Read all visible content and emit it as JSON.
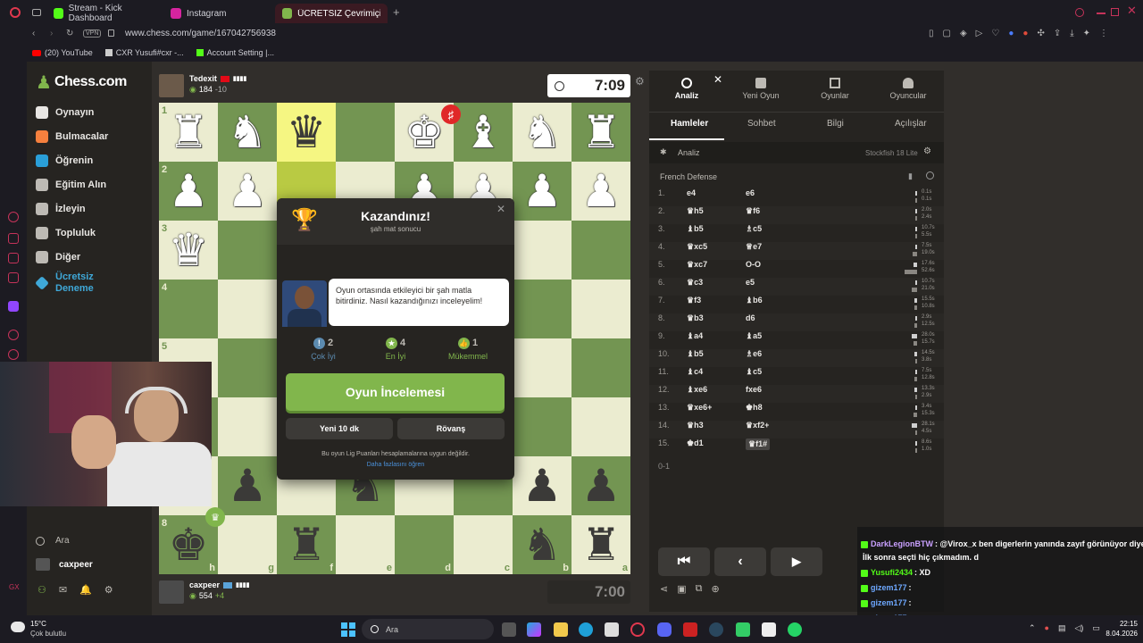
{
  "browser": {
    "tabs": [
      {
        "label": "Stream - Kick Dashboard"
      },
      {
        "label": "Instagram"
      },
      {
        "label": "ÜCRETSİZ Çevrimiçi Satra"
      }
    ],
    "vpn": "VPN",
    "url": "www.chess.com/game/167042756938",
    "bookmarks": [
      "(20) YouTube",
      "CXR Yusufi#cxr -...",
      "Account Setting |..."
    ]
  },
  "sidebar": {
    "logo": "Chess.com",
    "items": [
      {
        "label": "Oynayın",
        "icon": "pawn-icon",
        "color": "#e8e6e3"
      },
      {
        "label": "Bulmacalar",
        "icon": "puzzle-icon",
        "color": "#f5803e"
      },
      {
        "label": "Öğrenin",
        "icon": "learn-icon",
        "color": "#2a9fd8"
      },
      {
        "label": "Eğitim Alın",
        "icon": "coach-icon",
        "color": "#bdbab4"
      },
      {
        "label": "İzleyin",
        "icon": "binoculars-icon",
        "color": "#bdbab4"
      },
      {
        "label": "Topluluk",
        "icon": "community-icon",
        "color": "#bdbab4"
      },
      {
        "label": "Diğer",
        "icon": "more-icon",
        "color": "#bdbab4"
      },
      {
        "label": "Ücretsiz\nDeneme",
        "icon": "diamond-icon",
        "color": "#3fa8d8"
      }
    ],
    "search_label": "Ara",
    "user": "caxpeer"
  },
  "top_player": {
    "name": "Tedexit",
    "rating": "184",
    "delta": "-10",
    "clock": "7:09"
  },
  "bottom_player": {
    "name": "caxpeer",
    "rating": "554",
    "delta": "+4",
    "clock": "7:00"
  },
  "board": {
    "ranks": [
      "1",
      "2",
      "3",
      "4",
      "5",
      "6",
      "7",
      "8"
    ],
    "files": [
      "h",
      "g",
      "f",
      "e",
      "d",
      "c",
      "b",
      "a"
    ],
    "rows": [
      [
        "wR",
        "wN",
        "bQ",
        "",
        "wK",
        "wB",
        "wN",
        "wR"
      ],
      [
        "wP",
        "wP",
        "",
        "",
        "wP",
        "wP",
        "wP",
        "wP"
      ],
      [
        "wQ",
        "",
        "",
        "",
        "",
        "",
        "",
        ""
      ],
      [
        "",
        "",
        "",
        "",
        "",
        "",
        "",
        ""
      ],
      [
        "",
        "",
        "",
        "",
        "",
        "",
        "",
        ""
      ],
      [
        "",
        "",
        "",
        "",
        "",
        "",
        "",
        ""
      ],
      [
        "",
        "bP",
        "",
        "bN",
        "",
        "",
        "bP",
        "bP"
      ],
      [
        "bK",
        "",
        "bR",
        "",
        "",
        "",
        "bN",
        "bR"
      ]
    ]
  },
  "modal": {
    "title": "Kazandınız!",
    "subtitle": "şah mat sonucu",
    "coach_text": "Oyun ortasında etkileyici bir şah matla bitirdiniz. Nasıl kazandığınızı inceleyelim!",
    "stats": [
      {
        "value": "2",
        "label": "Çok İyi",
        "color": "#5c8bb0"
      },
      {
        "value": "4",
        "label": "En İyi",
        "color": "#81b64c"
      },
      {
        "value": "1",
        "label": "Mükemmel",
        "color": "#81b64c"
      }
    ],
    "review_button": "Oyun İncelemesi",
    "new_game_button": "Yeni 10 dk",
    "rematch_button": "Rövanş",
    "note": "Bu oyun Lig Puanları hesaplamalarına uygun değildir.",
    "learn_more": "Daha fazlasını öğren"
  },
  "panel": {
    "tabs": [
      "Analiz",
      "Yeni Oyun",
      "Oyunlar",
      "Oyuncular"
    ],
    "subtabs": [
      "Hamleler",
      "Sohbet",
      "Bilgi",
      "Açılışlar"
    ],
    "analysis_label": "Analiz",
    "engine": "Stockfish 18 Lite",
    "opening": "French Defense",
    "moves": [
      {
        "n": "1.",
        "w": "e4",
        "b": "e6",
        "tw": "0.1s",
        "tb": "0.1s",
        "fw": 0.01,
        "fb": 0.01
      },
      {
        "n": "2.",
        "w": "♛h5",
        "b": "♛f6",
        "tw": "2.0s",
        "tb": "2.4s",
        "fw": 0.04,
        "fb": 0.05
      },
      {
        "n": "3.",
        "w": "♝b5",
        "b": "♗c5",
        "tw": "10.7s",
        "tb": "5.5s",
        "fw": 0.2,
        "fb": 0.1
      },
      {
        "n": "4.",
        "w": "♛xc5",
        "b": "♕e7",
        "tw": "7.5s",
        "tb": "19.0s",
        "fw": 0.14,
        "fb": 0.36
      },
      {
        "n": "5.",
        "w": "♛xc7",
        "b": "O-O",
        "tw": "17.6s",
        "tb": "52.6s",
        "fw": 0.33,
        "fb": 1.0
      },
      {
        "n": "6.",
        "w": "♛c3",
        "b": "e5",
        "tw": "10.7s",
        "tb": "21.0s",
        "fw": 0.2,
        "fb": 0.4
      },
      {
        "n": "7.",
        "w": "♛f3",
        "b": "♝b6",
        "tw": "15.5s",
        "tb": "10.8s",
        "fw": 0.29,
        "fb": 0.2
      },
      {
        "n": "8.",
        "w": "♛b3",
        "b": "d6",
        "tw": "2.9s",
        "tb": "12.5s",
        "fw": 0.05,
        "fb": 0.24
      },
      {
        "n": "9.",
        "w": "♝a4",
        "b": "♝a5",
        "tw": "28.0s",
        "tb": "15.7s",
        "fw": 0.53,
        "fb": 0.3
      },
      {
        "n": "10.",
        "w": "♝b5",
        "b": "♗e6",
        "tw": "14.5s",
        "tb": "3.8s",
        "fw": 0.28,
        "fb": 0.07
      },
      {
        "n": "11.",
        "w": "♝c4",
        "b": "♝c5",
        "tw": "7.5s",
        "tb": "12.8s",
        "fw": 0.14,
        "fb": 0.24
      },
      {
        "n": "12.",
        "w": "♝xe6",
        "b": "fxe6",
        "tw": "13.3s",
        "tb": "2.9s",
        "fw": 0.25,
        "fb": 0.05
      },
      {
        "n": "13.",
        "w": "♛xe6+",
        "b": "♚h8",
        "tw": "3.4s",
        "tb": "15.3s",
        "fw": 0.06,
        "fb": 0.29
      },
      {
        "n": "14.",
        "w": "♛h3",
        "b": "♛xf2+",
        "tw": "28.1s",
        "tb": "4.5s",
        "fw": 0.53,
        "fb": 0.08
      },
      {
        "n": "15.",
        "w": "♚d1",
        "b": "♛f1#",
        "tw": "8.6s",
        "tb": "1.0s",
        "fw": 0.16,
        "fb": 0.02
      }
    ],
    "result": "0-1"
  },
  "chat": [
    {
      "user": "DarkLegionBTW",
      "color": "#c9a0ff",
      "msg": ": @Virox_x ben digerlerin yanında zayıf görünüyor diye"
    },
    {
      "user": "",
      "color": "#ffffff",
      "msg": "İlk sonra seçti hiç çıkmadım. d"
    },
    {
      "user": "Yusufi2434",
      "color": "#53fc18",
      "msg": ": XD"
    },
    {
      "user": "gizem177",
      "color": "#6ea8ff",
      "msg": ":"
    },
    {
      "user": "gizem177",
      "color": "#6ea8ff",
      "msg": ":"
    },
    {
      "user": "gizem177",
      "color": "#6ea8ff",
      "msg": ":"
    },
    {
      "user": "salmiyaa",
      "color": "#ff4d6d",
      "msg": ": esrdtfyg"
    }
  ],
  "taskbar": {
    "weather_temp": "15°C",
    "weather_text": "Çok bulutlu",
    "search": "Ara",
    "time": "22:15",
    "date": "8.04.2026"
  }
}
